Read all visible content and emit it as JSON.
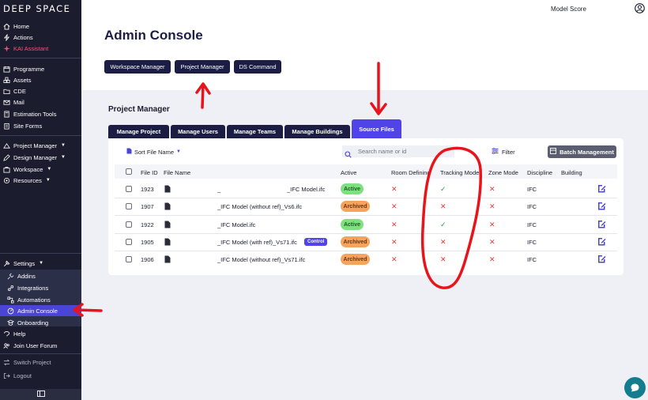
{
  "sidebar": {
    "logo": "DEEP SPACE",
    "group1": [
      {
        "label": "Home",
        "icon": "home-icon"
      },
      {
        "label": "Actions",
        "icon": "bolt-icon"
      },
      {
        "label": "KAI Assistant",
        "icon": "sparkle-icon"
      }
    ],
    "group2": [
      {
        "label": "Programme",
        "icon": "calendar-icon"
      },
      {
        "label": "Assets",
        "icon": "boxes-icon"
      },
      {
        "label": "CDE",
        "icon": "folder-icon"
      },
      {
        "label": "Mail",
        "icon": "mail-icon"
      },
      {
        "label": "Estimation Tools",
        "icon": "calculator-icon"
      },
      {
        "label": "Site Forms",
        "icon": "clipboard-icon"
      }
    ],
    "group3": [
      {
        "label": "Project Manager",
        "icon": "project-icon"
      },
      {
        "label": "Design Manager",
        "icon": "design-icon"
      },
      {
        "label": "Workspace",
        "icon": "workspace-icon"
      },
      {
        "label": "Resources",
        "icon": "resources-icon"
      }
    ],
    "settings": {
      "label": "Settings",
      "icon": "tools-icon"
    },
    "settings_items": [
      {
        "label": "Addins",
        "icon": "plug-icon"
      },
      {
        "label": "Integrations",
        "icon": "link-icon"
      },
      {
        "label": "Automations",
        "icon": "automation-icon"
      },
      {
        "label": "Admin Console",
        "icon": "gauge-icon"
      },
      {
        "label": "Onboarding",
        "icon": "onboarding-icon"
      }
    ],
    "bottom": [
      {
        "label": "Help",
        "icon": "help-icon"
      },
      {
        "label": "Join User Forum",
        "icon": "forum-icon"
      }
    ],
    "switch_project": "Switch Project",
    "logout": "Logout"
  },
  "header": {
    "model_score": "Model Score"
  },
  "page": {
    "title": "Admin Console",
    "top_buttons": [
      "Workspace Manager",
      "Project Manager",
      "DS Command"
    ],
    "section_title": "Project Manager",
    "tabs": [
      "Manage Project",
      "Manage Users",
      "Manage Teams",
      "Manage Buildings",
      "Source Files"
    ]
  },
  "toolbar": {
    "sort_label": "Sort File Name",
    "search_placeholder": "Search name or id",
    "filter_label": "Filter",
    "batch_label": "Batch Management"
  },
  "table": {
    "headers": [
      "File ID",
      "File Name",
      "Active",
      "Room Defining",
      "Tracking Mode",
      "Zone Mode",
      "Discipline",
      "Building"
    ],
    "rows": [
      {
        "id": "1923",
        "name_prefix": "_",
        "name": "_IFC Model.ifc",
        "status": "Active",
        "room": "x",
        "tracking": "check",
        "zone": "x",
        "discipline": "IFC",
        "tag": ""
      },
      {
        "id": "1907",
        "name_prefix": "",
        "name": "_IFC Model (without ref)_Vs6.ifc",
        "status": "Archived",
        "room": "x",
        "tracking": "x",
        "zone": "x",
        "discipline": "IFC",
        "tag": ""
      },
      {
        "id": "1922",
        "name_prefix": "",
        "name": "_IFC Model.ifc",
        "status": "Active",
        "room": "x",
        "tracking": "check",
        "zone": "x",
        "discipline": "IFC",
        "tag": ""
      },
      {
        "id": "1905",
        "name_prefix": "",
        "name": "_IFC Model (with ref)_Vs71.ifc",
        "status": "Archived",
        "room": "x",
        "tracking": "x",
        "zone": "x",
        "discipline": "IFC",
        "tag": "Control"
      },
      {
        "id": "1906",
        "name_prefix": "",
        "name": "_IFC Model (without ref)_Vs71.ifc",
        "status": "Archived",
        "room": "x",
        "tracking": "x",
        "zone": "x",
        "discipline": "IFC",
        "tag": ""
      }
    ]
  },
  "colors": {
    "sidebar_bg": "#1b1d2e",
    "accent": "#5044e8",
    "navy": "#1b1d45",
    "annotation": "#e8141b",
    "active_badge": "#7fe07f",
    "archived_badge": "#f5a35d"
  }
}
